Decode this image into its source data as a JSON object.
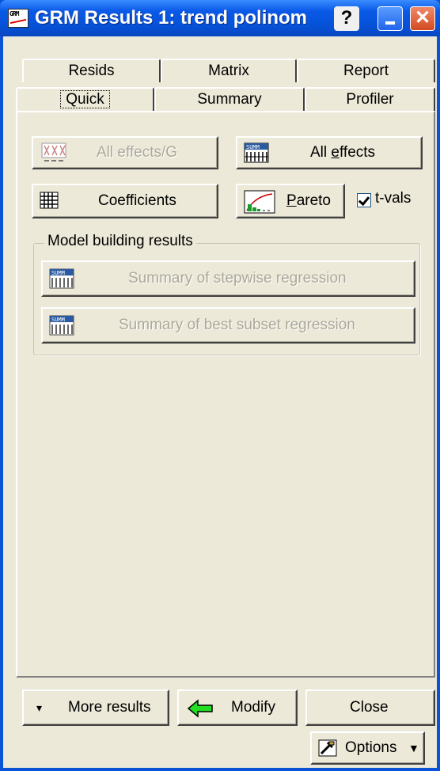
{
  "window": {
    "title": "GRM Results 1: trend polinom",
    "icon": "grm-app-icon"
  },
  "titlebar_buttons": {
    "help": "?",
    "minimize": "_",
    "close": "✕"
  },
  "tabs_row1": [
    "Resids",
    "Matrix",
    "Report"
  ],
  "tabs_row2": [
    "Quick",
    "Summary",
    "Profiler"
  ],
  "active_tab": "Quick",
  "buttons": {
    "all_effects_g": "All effects/G",
    "all_effects": "All effects",
    "coefficients": "Coefficients",
    "pareto": "Pareto",
    "t_vals": "t-vals"
  },
  "t_vals_checked": true,
  "group": {
    "title": "Model building results",
    "stepwise": "Summary of stepwise regression",
    "best_subset": "Summary of best subset regression"
  },
  "footer": {
    "more_results": "More results",
    "modify": "Modify",
    "close": "Close",
    "options": "Options"
  }
}
